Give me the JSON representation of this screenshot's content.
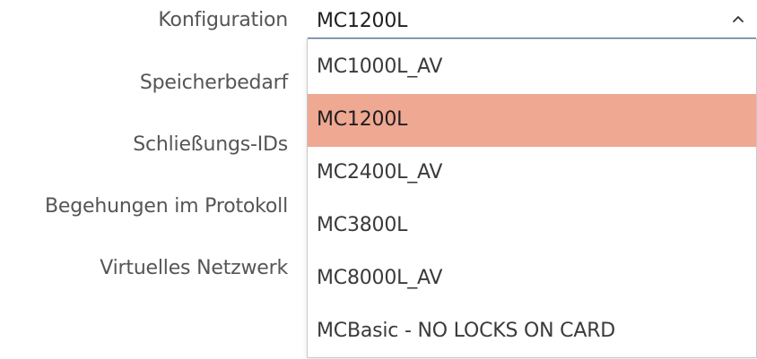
{
  "form": {
    "labels": {
      "konfiguration": "Konfiguration",
      "speicherbedarf": "Speicherbedarf",
      "schliessungs_ids": "Schließungs-IDs",
      "begehungen": "Begehungen im Protokoll",
      "virtuelles_netzwerk": "Virtuelles Netzwerk"
    }
  },
  "dropdown": {
    "selected_value": "MC1200L",
    "chevron_icon": "chevron-up-icon",
    "selected_color": "#efa892",
    "options": [
      "MC1000L_AV",
      "MC1200L",
      "MC2400L_AV",
      "MC3800L",
      "MC8000L_AV",
      "MCBasic - NO LOCKS ON CARD"
    ]
  }
}
